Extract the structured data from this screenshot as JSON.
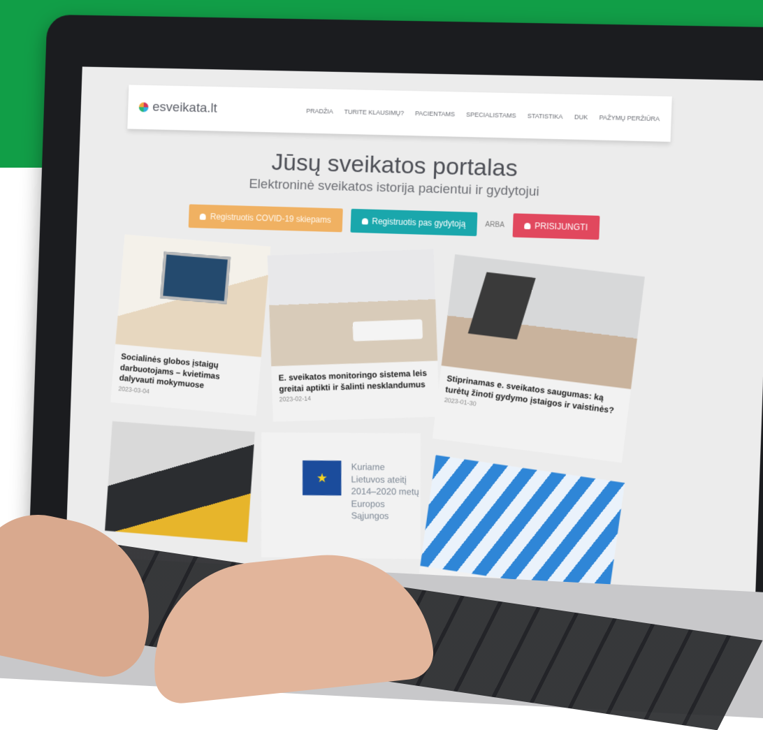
{
  "brand": {
    "name": "esveikata.lt"
  },
  "nav": {
    "items": [
      "PRADŽIA",
      "TURITE KLAUSIMŲ?",
      "PACIENTAMS",
      "SPECIALISTAMS",
      "STATISTIKA",
      "DUK",
      "PAŽYMŲ PERŽIŪRA"
    ]
  },
  "hero": {
    "title": "Jūsų sveikatos portalas",
    "subtitle": "Elektroninė sveikatos istorija pacientui ir gydytojui"
  },
  "actions": {
    "covid": "Registruotis COVID-19 skiepams",
    "doctor": "Registruotis pas gydytoją",
    "or": "ARBA",
    "login": "PRISIJUNGTI"
  },
  "news": [
    {
      "title": "Socialinės globos įstaigų darbuotojams – kvietimas dalyvauti mokymuose",
      "date": "2023-03-04"
    },
    {
      "title": "E. sveikatos monitoringo sistema leis greitai aptikti ir šalinti nesklandumus",
      "date": "2023-02-14"
    },
    {
      "title": "Stiprinamas e. sveikatos saugumas: ką turėtų žinoti gydymo įstaigos ir vaistinės?",
      "date": "2023-01-30"
    }
  ],
  "eu": {
    "line1": "Kuriame",
    "line2": "Lietuvos ateitį",
    "line3": "2014–2020 metų",
    "line4": "Europos Sąjungos"
  },
  "colors": {
    "background_band": "#119e47",
    "covid_button": "#f0b162",
    "doctor_button": "#1aa7ac",
    "login_button": "#e1485e"
  }
}
